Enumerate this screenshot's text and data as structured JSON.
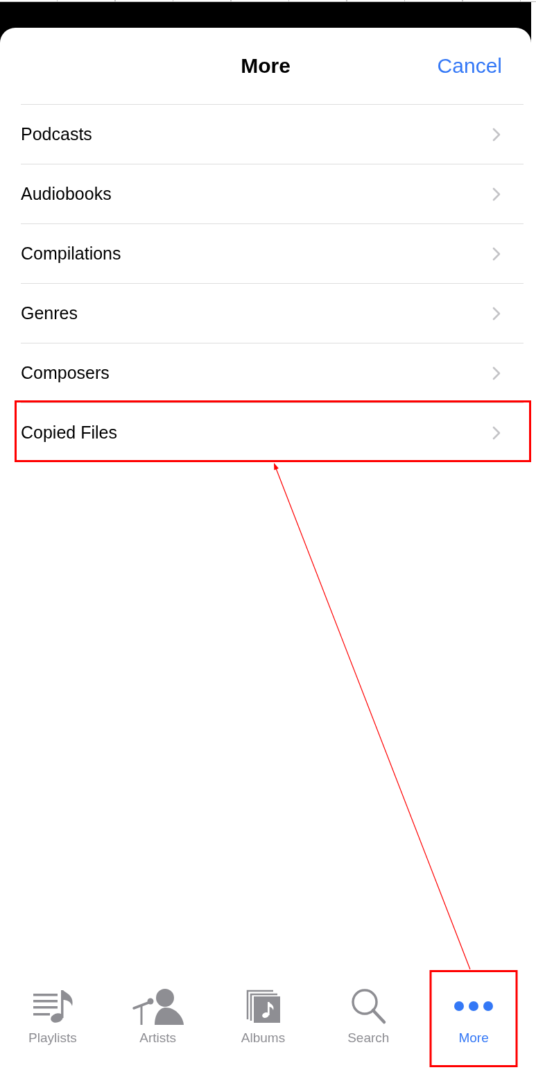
{
  "sheet": {
    "title": "More",
    "cancel": "Cancel"
  },
  "rows": [
    {
      "label": "Podcasts",
      "highlighted": false
    },
    {
      "label": "Audiobooks",
      "highlighted": false
    },
    {
      "label": "Compilations",
      "highlighted": false
    },
    {
      "label": "Genres",
      "highlighted": false
    },
    {
      "label": "Composers",
      "highlighted": false
    },
    {
      "label": "Copied Files",
      "highlighted": true
    }
  ],
  "tab_bar": {
    "tabs": [
      {
        "label": "Playlists",
        "kind": "playlists",
        "selected": false,
        "highlighted": false
      },
      {
        "label": "Artists",
        "kind": "artists",
        "selected": false,
        "highlighted": false
      },
      {
        "label": "Albums",
        "kind": "albums",
        "selected": false,
        "highlighted": false
      },
      {
        "label": "Search",
        "kind": "search",
        "selected": false,
        "highlighted": false
      },
      {
        "label": "More",
        "kind": "more",
        "selected": true,
        "highlighted": true
      }
    ]
  }
}
